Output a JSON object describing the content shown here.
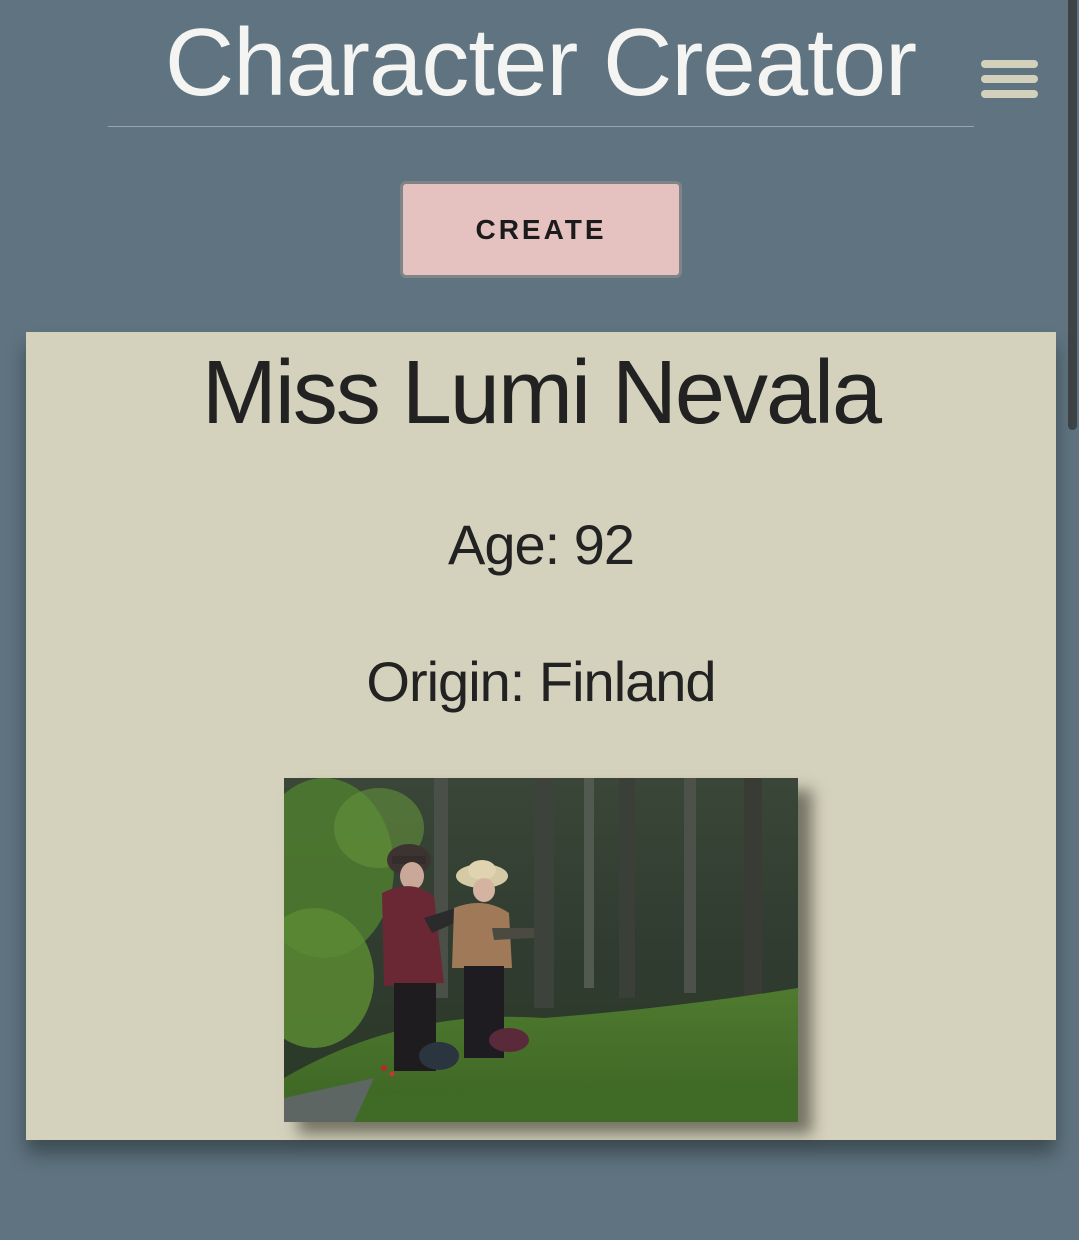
{
  "header": {
    "title": "Character Creator",
    "menu_icon": "hamburger-menu-icon"
  },
  "actions": {
    "create_label": "CREATE"
  },
  "character": {
    "name": "Miss Lumi Nevala",
    "age_text": "Age: 92",
    "origin_text": "Origin: Finland",
    "photo_description_icon": "character-photo"
  },
  "colors": {
    "background": "#5f7480",
    "card": "#d4d1bc",
    "button": "#e5c1bf",
    "title_text": "#f4f4f2",
    "menu_icon": "#d3d1bc"
  }
}
